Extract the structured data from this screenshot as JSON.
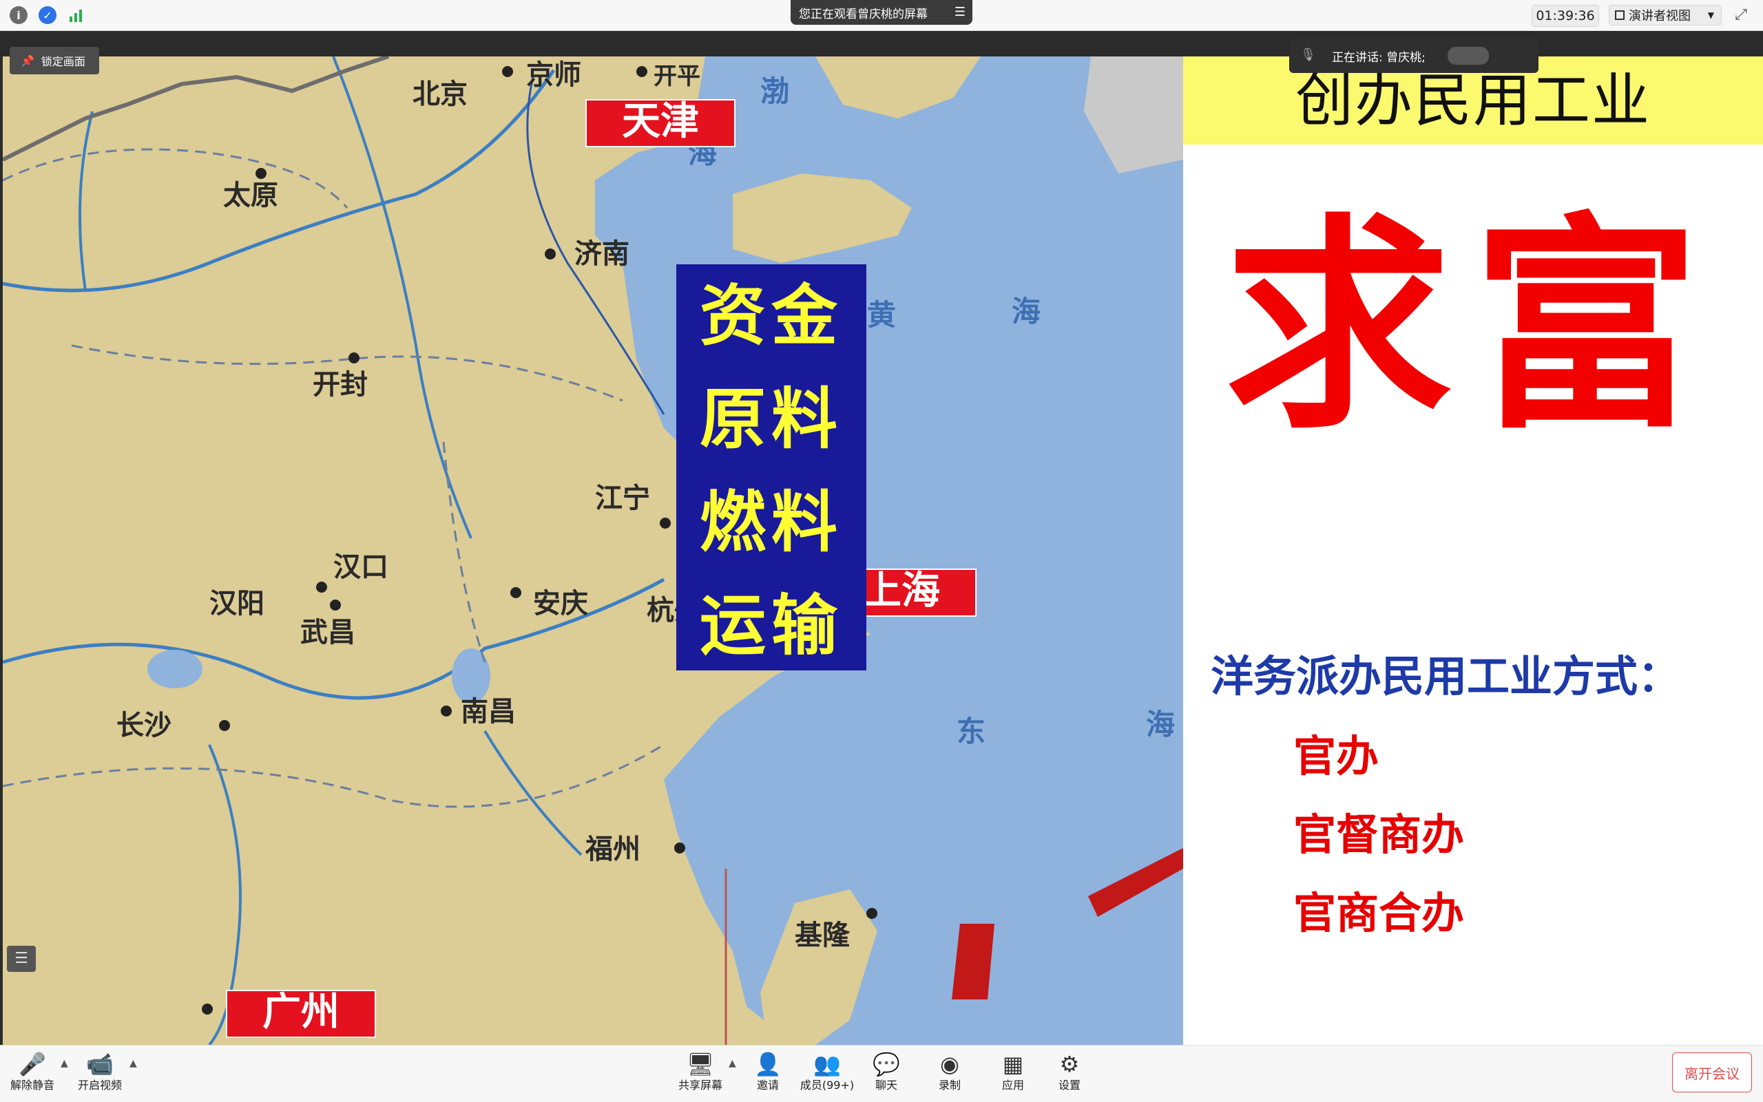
{
  "topbar": {
    "viewing_text": "您正在观看曾庆桃的屏幕",
    "menu_glyph": "☰",
    "clock": "01:39:36",
    "view_mode": "演讲者视图"
  },
  "stage": {
    "lock_label": "锁定画面",
    "talking_text": "正在讲话: 曾庆桃;"
  },
  "slide": {
    "title": "创办民用工业",
    "big_text": "求富",
    "methods_title": "洋务派办民用工业方式：",
    "methods": [
      "官办",
      "官督商办",
      "官商合办"
    ],
    "blue_box": [
      "资金",
      "原料",
      "燃料",
      "运输"
    ],
    "red_labels": {
      "tianjin": "天津",
      "shanghai": "上海",
      "guangzhou": "广州"
    },
    "map_places": {
      "jingshi": "京师",
      "kaiping": "开平",
      "beijing": "北京",
      "taiyuan": "太原",
      "jinan": "济南",
      "kaifeng": "开封",
      "jiangning": "江宁",
      "hankou": "汉口",
      "hanyang": "汉阳",
      "wuchang": "武昌",
      "anqing": "安庆",
      "hangzhou": "杭州",
      "nanchang": "南昌",
      "changsha": "长沙",
      "fuzhou": "福州",
      "jilong": "基隆",
      "bo": "渤",
      "hai1": "海",
      "huang": "黄",
      "hai2": "海",
      "dong": "东",
      "hai3": "海"
    }
  },
  "toolbar": {
    "unmute": "解除静音",
    "start_video": "开启视频",
    "share_screen": "共享屏幕",
    "invite": "邀请",
    "members": "成员(99+)",
    "chat": "聊天",
    "record": "录制",
    "apps": "应用",
    "settings": "设置",
    "leave": "离开会议"
  }
}
